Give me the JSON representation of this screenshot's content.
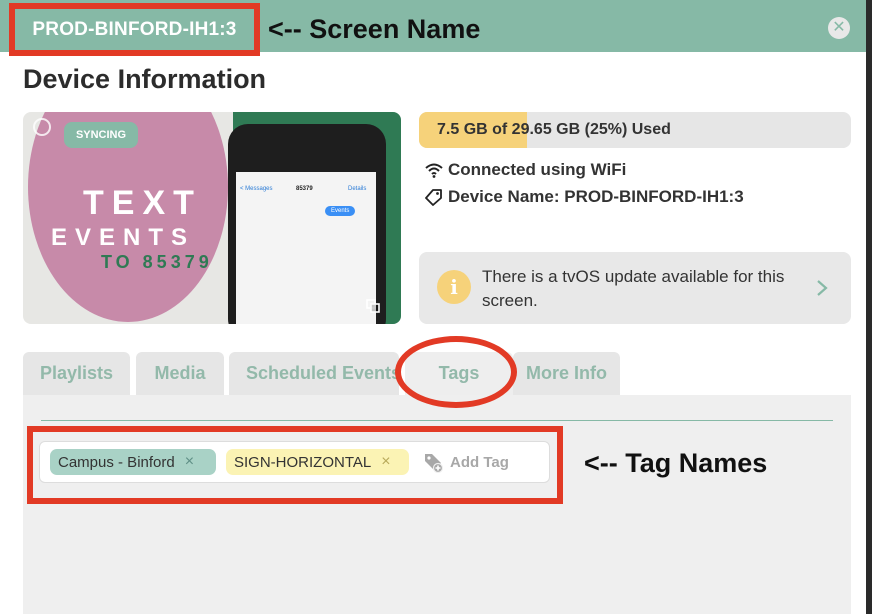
{
  "header": {
    "screen_name": "PROD-BINFORD-IH1:3",
    "annotation": "<-- Screen Name",
    "close_icon": "close-icon",
    "bar_color": "#86b9a6"
  },
  "page": {
    "heading": "Device Information"
  },
  "preview": {
    "status_badge": "SYNCING",
    "artwork_text": {
      "line1": "TEXT",
      "line2": "EVENTS",
      "line3": "TO 85379",
      "phone_back": "< Messages",
      "phone_number": "85379",
      "phone_details": "Details",
      "phone_bubble": "Events"
    },
    "expand_icon": "copy-icon"
  },
  "storage": {
    "label": "7.5 GB of 29.65 GB (25%) Used",
    "used_fraction": 0.25,
    "fill_color": "#f6d27a"
  },
  "connection": {
    "icon": "wifi-icon",
    "label": "Connected using WiFi"
  },
  "device_name": {
    "icon": "tag-icon",
    "label": "Device Name: PROD-BINFORD-IH1:3"
  },
  "update_notice": {
    "icon": "info-icon",
    "icon_glyph": "i",
    "text": "There is a tvOS update available for this screen.",
    "chevron_icon": "chevron-right-icon"
  },
  "tabs": [
    {
      "label": "Playlists"
    },
    {
      "label": "Media"
    },
    {
      "label": "Scheduled Events"
    },
    {
      "label": "Tags",
      "active": true
    },
    {
      "label": "More Info"
    }
  ],
  "tags": {
    "items": [
      {
        "label": "Campus - Binford",
        "remove": "×",
        "color": "#a9d2c6"
      },
      {
        "label": "SIGN-HORIZONTAL",
        "remove": "×",
        "color": "#fbf3b4"
      }
    ],
    "add_label": "Add Tag",
    "add_icon": "add-tag-icon",
    "annotation": "<-- Tag Names"
  },
  "annotation_color": "#e23a25"
}
